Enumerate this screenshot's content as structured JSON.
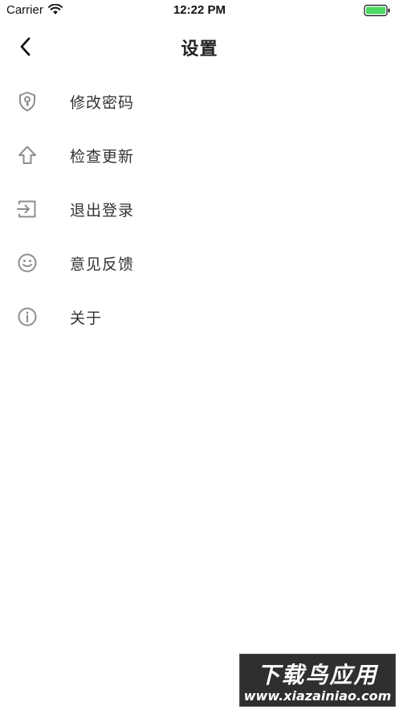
{
  "status_bar": {
    "carrier": "Carrier",
    "time": "12:22 PM",
    "battery_color": "#4cd964"
  },
  "nav": {
    "title": "设置",
    "back_icon": "chevron-left-icon"
  },
  "settings": {
    "items": [
      {
        "label": "修改密码",
        "icon": "shield-key-icon"
      },
      {
        "label": "检查更新",
        "icon": "arrow-up-icon"
      },
      {
        "label": "退出登录",
        "icon": "logout-icon"
      },
      {
        "label": "意见反馈",
        "icon": "smiley-icon"
      },
      {
        "label": "关于",
        "icon": "info-icon"
      }
    ],
    "icon_color": "#8e8e8e"
  },
  "watermark": {
    "title": "下载鸟应用",
    "url": "www.xiazainiao.com"
  }
}
